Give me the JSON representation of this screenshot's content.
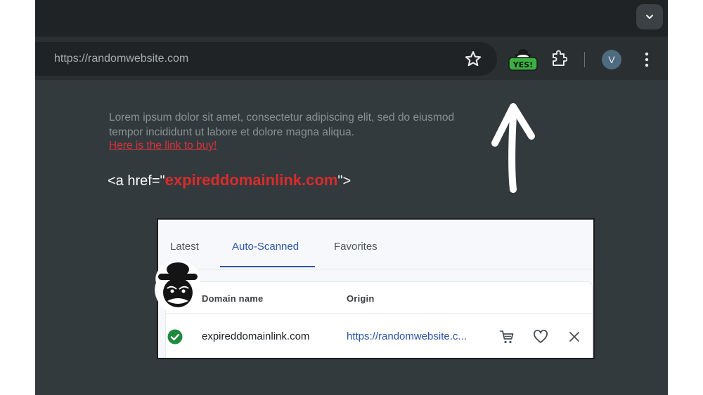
{
  "browser": {
    "url": "https://randomwebsite.com",
    "extension_badge": "YES!",
    "profile_initial": "V"
  },
  "page": {
    "lorem": "Lorem ipsum dolor sit amet, consectetur adipiscing elit, sed do eiusmod tempor incididunt ut labore et dolore magna aliqua.",
    "buy_link": "Here is the link to buy!",
    "code_prefix": "<a href=\"",
    "code_domain": "expireddomainlink.com",
    "code_suffix": "\">"
  },
  "panel": {
    "tabs": [
      {
        "label": "Latest"
      },
      {
        "label": "Auto-Scanned",
        "active": true
      },
      {
        "label": "Favorites"
      }
    ],
    "columns": {
      "domain": "Domain name",
      "origin": "Origin"
    },
    "rows": [
      {
        "domain": "expireddomainlink.com",
        "origin": "https://randomwebsite.c...",
        "status_icon": "check-circle-icon"
      }
    ]
  },
  "colors": {
    "accent_blue": "#2e56a8",
    "status_green": "#1e8a3e",
    "link_red": "#d92b2b",
    "badge_green": "#3cb043"
  }
}
